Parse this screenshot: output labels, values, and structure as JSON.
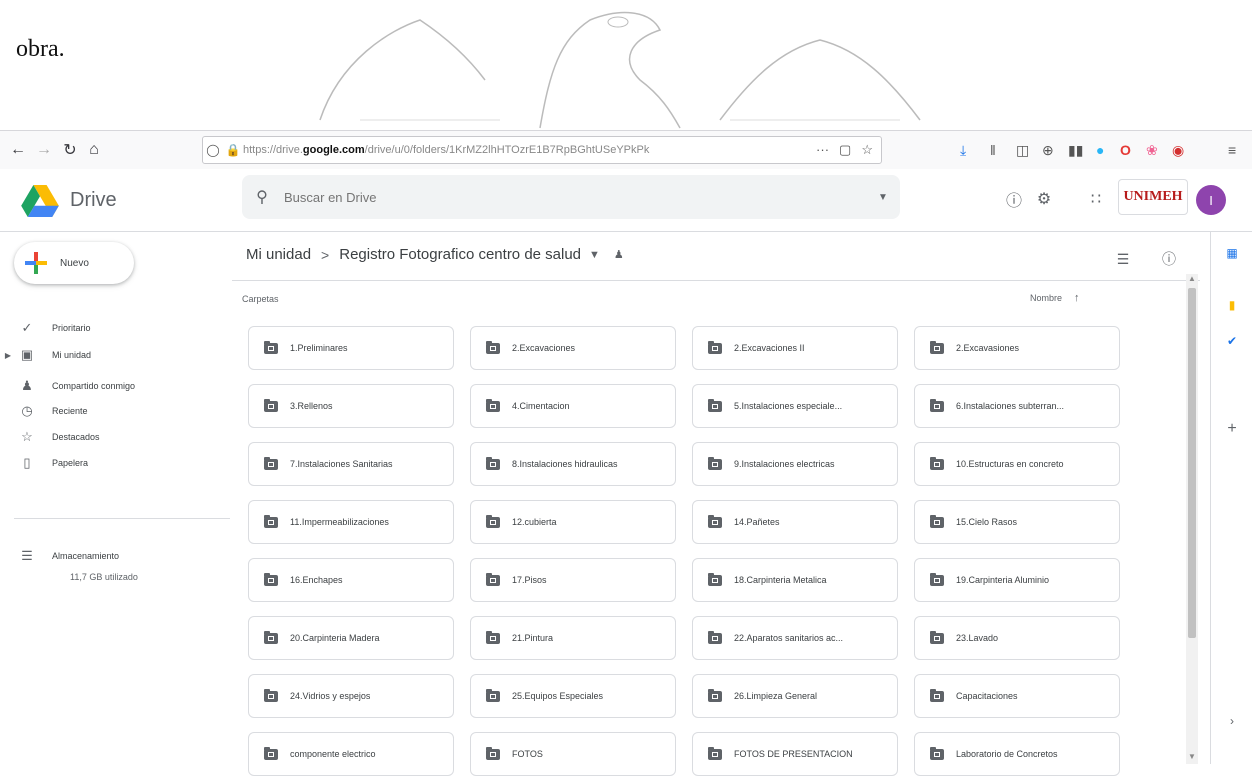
{
  "document": {
    "fragment": "obra."
  },
  "browser": {
    "url_prefix": "https://drive.",
    "url_domain": "google.com",
    "url_rest": "/drive/u/0/folders/1KrMZ2lhHTOzrE1B7RpBGhtUSeYPkPk",
    "url_more": "···"
  },
  "header": {
    "brand": "Drive",
    "search_placeholder": "Buscar en Drive",
    "org_logo": "UNIMEH",
    "avatar_initial": "I"
  },
  "sidebar": {
    "new_label": "Nuevo",
    "items": [
      {
        "label": "Prioritario",
        "icon": "check-circle-icon"
      },
      {
        "label": "Mi unidad",
        "icon": "drive-icon"
      },
      {
        "label": "Compartido conmigo",
        "icon": "people-icon"
      },
      {
        "label": "Reciente",
        "icon": "clock-icon"
      },
      {
        "label": "Destacados",
        "icon": "star-icon"
      },
      {
        "label": "Papelera",
        "icon": "trash-icon"
      }
    ],
    "storage_label": "Almacenamiento",
    "storage_used": "11,7 GB utilizado"
  },
  "main": {
    "breadcrumb_root": "Mi unidad",
    "breadcrumb_sep": ">",
    "breadcrumb_current": "Registro Fotografico centro de salud",
    "section_label": "Carpetas",
    "sort_label": "Nombre",
    "folders": [
      "1.Preliminares",
      "2.Excavaciones",
      "2.Excavaciones II",
      "2.Excavasiones",
      "3.Rellenos",
      "4.Cimentacion",
      "5.Instalaciones especiale...",
      "6.Instalaciones subterran...",
      "7.Instalaciones Sanitarias",
      "8.Instalaciones hidraulicas",
      "9.Instalaciones electricas",
      "10.Estructuras en concreto",
      "11.Impermeabilizaciones",
      "12.cubierta",
      "14.Pañetes",
      "15.Cielo Rasos",
      "16.Enchapes",
      "17.Pisos",
      "18.Carpinteria Metalica",
      "19.Carpinteria Aluminio",
      "20.Carpinteria Madera",
      "21.Pintura",
      "22.Aparatos sanitarios ac...",
      "23.Lavado",
      "24.Vidrios y espejos",
      "25.Equipos Especiales",
      "26.Limpieza General",
      "Capacitaciones",
      "componente electrico",
      "FOTOS",
      "FOTOS DE PRESENTACION",
      "Laboratorio de Concretos"
    ]
  }
}
